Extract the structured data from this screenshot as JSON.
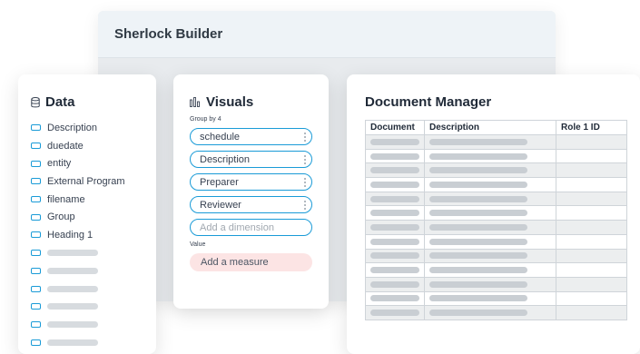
{
  "builder": {
    "title": "Sherlock Builder"
  },
  "data_panel": {
    "title": "Data",
    "icon": "database-icon",
    "fields": [
      "Description",
      "duedate",
      "entity",
      "External Program",
      "filename",
      "Group",
      "Heading 1"
    ],
    "placeholder_rows": 6
  },
  "visuals_panel": {
    "title": "Visuals",
    "icon": "bar-chart-icon",
    "group_label": "Group by 4",
    "dimensions": [
      "schedule",
      "Description",
      "Preparer",
      "Reviewer"
    ],
    "add_dimension": "Add a dimension",
    "value_label": "Value",
    "add_measure": "Add a measure"
  },
  "document_manager": {
    "title": "Document Manager",
    "columns": [
      "Document",
      "Description",
      "Role 1 ID"
    ],
    "row_count": 13
  },
  "colors": {
    "accent": "#1a9bd7",
    "measure_bg": "#fce4e4",
    "skeleton": "#c9ced3"
  }
}
